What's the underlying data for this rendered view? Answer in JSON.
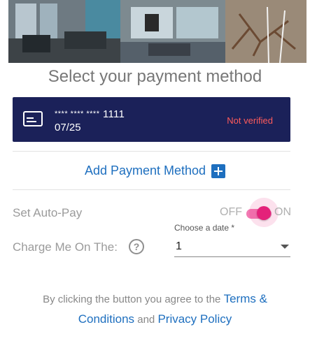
{
  "page": {
    "title": "Select your payment method"
  },
  "card": {
    "mask": "**** **** ****",
    "last4": "1111",
    "expiry": "07/25",
    "status": "Not verified"
  },
  "add_payment": {
    "label": "Add Payment Method"
  },
  "autopay": {
    "label": "Set Auto-Pay",
    "off_label": "OFF",
    "on_label": "ON",
    "enabled": true
  },
  "charge": {
    "label": "Charge Me On The:",
    "help_icon": "question-circle-icon",
    "select_label": "Choose a date *",
    "selected_value": "1"
  },
  "legal": {
    "prefix": "By clicking the button you agree to the",
    "terms_link": "Terms & Conditions",
    "conjunction": "and",
    "privacy_link": "Privacy Policy"
  },
  "colors": {
    "card_bg": "#1b2159",
    "link": "#1e6fbf",
    "toggle_accent": "#e4217a",
    "status_warning": "#ff5b5b"
  }
}
